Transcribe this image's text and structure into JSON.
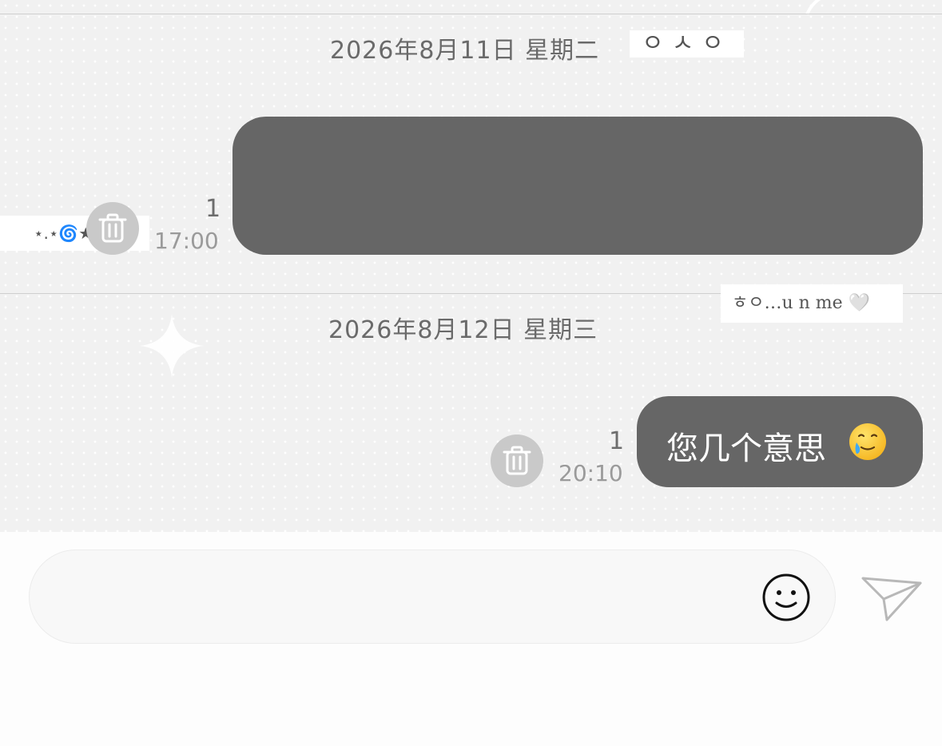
{
  "chat": {
    "day1": {
      "date": "2026年8月11日 星期二",
      "sticker": "ㅇㅅㅇ"
    },
    "day2": {
      "date": "2026年8月12日 星期三",
      "sticker": "ㅎㅇ…u n me 🤍"
    },
    "left_sticker": "⋆.⋆🌀★",
    "messages": [
      {
        "text": "",
        "unread": "1",
        "time": "17:00"
      },
      {
        "text": "您几个意思",
        "emoji": "face-holding-back-tears",
        "unread": "1",
        "time": "20:10"
      }
    ]
  },
  "composer": {
    "placeholder": "",
    "icons": [
      "smiley-icon",
      "paper-plane-send-icon"
    ]
  },
  "colors": {
    "bubble": "#666666",
    "chat_background": "#f1f1f1",
    "trash_button": "#c9c9c9"
  }
}
